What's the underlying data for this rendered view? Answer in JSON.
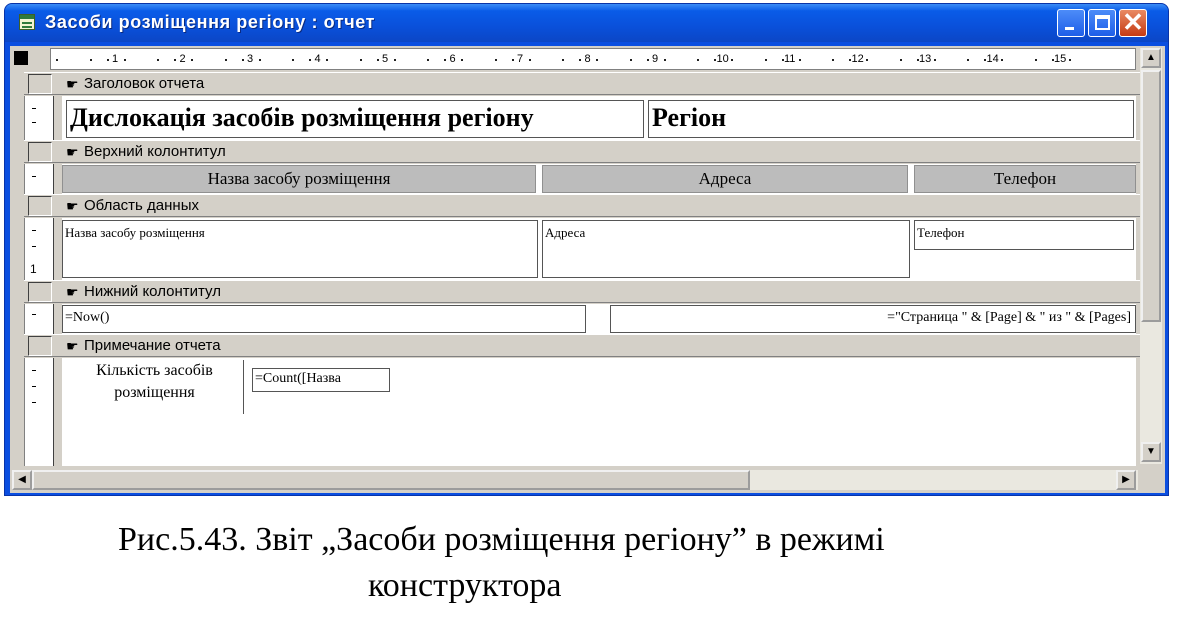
{
  "window": {
    "title": "Засоби розміщення регіону : отчет",
    "close_glyph": "✕"
  },
  "ruler": {
    "numbers": [
      "1",
      "2",
      "3",
      "4",
      "5",
      "6",
      "7",
      "8",
      "9",
      "10",
      "11",
      "12",
      "13",
      "14",
      "15"
    ]
  },
  "vertical_ruler": {
    "detail_mark": "1"
  },
  "sections": {
    "report_header": {
      "label": "Заголовок отчета",
      "title_text": "Дислокація засобів розміщення регіону",
      "region_text": "Регіон"
    },
    "page_header": {
      "label": "Верхний колонтитул",
      "columns": [
        "Назва засобу розміщення",
        "Адреса",
        "Телефон"
      ]
    },
    "detail": {
      "label": "Область данных",
      "fields": [
        "Назва засобу розміщення",
        "Адреса",
        "Телефон"
      ]
    },
    "page_footer": {
      "label": "Нижний колонтитул",
      "left_expr": "=Now()",
      "right_expr": "=\"Страница \" & [Page] & \" из \" & [Pages]"
    },
    "report_footer": {
      "label": "Примечание отчета",
      "count_label_line1": "Кількість засобів",
      "count_label_line2": "розміщення",
      "count_expr": "=Count([Назва"
    }
  },
  "caption": {
    "line1": "Рис.5.43. Звіт „Засоби розміщення регіону” в режимі",
    "line2": "конструктора"
  },
  "colors": {
    "titlebar": "#0a50da",
    "close_button": "#c53a13",
    "face": "#d4d0c8",
    "header_cell": "#bcbcbc"
  }
}
